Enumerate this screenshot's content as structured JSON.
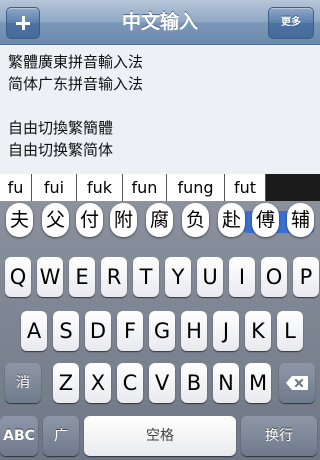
{
  "nav": {
    "title": "中文输入",
    "more_label": "更多"
  },
  "text_lines": [
    "繁體廣東拼音輸入法",
    "简体广东拼音输入法",
    "",
    "自由切換繁簡體",
    "自由切换繁简体"
  ],
  "pinyin_candidates": [
    "fu",
    "fui",
    "fuk",
    "fun",
    "fung",
    "fut"
  ],
  "hanzi_candidates": [
    "夫",
    "父",
    "付",
    "附",
    "腐",
    "负",
    "赴",
    "傅",
    "辅"
  ],
  "keyboard": {
    "row1": [
      "Q",
      "W",
      "E",
      "R",
      "T",
      "Y",
      "U",
      "I",
      "O",
      "P"
    ],
    "row2": [
      "A",
      "S",
      "D",
      "F",
      "G",
      "H",
      "J",
      "K",
      "L"
    ],
    "row3": [
      "Z",
      "X",
      "C",
      "V",
      "B",
      "N",
      "M"
    ],
    "left_mod": "消",
    "abc": "ABC",
    "globe_key": "广",
    "space": "空格",
    "return": "换行"
  },
  "colors": {
    "navbar": "#7c97b8",
    "highlight": "#3a6fd0",
    "keyboard_bg": "#7a8392"
  }
}
